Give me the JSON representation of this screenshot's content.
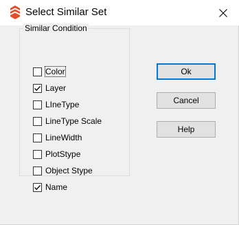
{
  "window": {
    "title": "Select Similar Set",
    "app_icon": "app-logo-icon",
    "close_icon": "close-icon"
  },
  "group": {
    "legend": "Similar Condition",
    "items": [
      {
        "label": "Color",
        "checked": false
      },
      {
        "label": "Layer",
        "checked": true
      },
      {
        "label": "LIneType",
        "checked": false
      },
      {
        "label": "LineType Scale",
        "checked": false
      },
      {
        "label": "LineWidth",
        "checked": false
      },
      {
        "label": "PlotStype",
        "checked": false
      },
      {
        "label": "Object Stype",
        "checked": false
      },
      {
        "label": "Name",
        "checked": true
      }
    ]
  },
  "buttons": {
    "ok": "Ok",
    "cancel": "Cancel",
    "help": "Help"
  },
  "colors": {
    "accent": "#0078d7",
    "logo": "#e0502a"
  }
}
